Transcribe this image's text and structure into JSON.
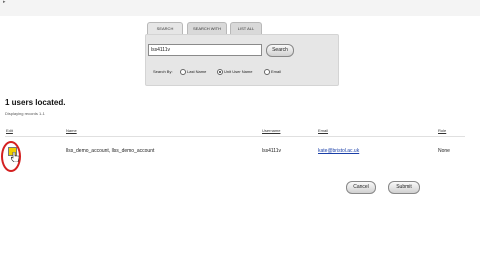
{
  "browser": {
    "corner_text": "▸"
  },
  "tabs": [
    {
      "label": "SEARCH",
      "active": true
    },
    {
      "label": "SEARCH WITH",
      "active": false
    },
    {
      "label": "LIST ALL",
      "active": false
    }
  ],
  "search": {
    "value": "lss4111v",
    "button_label": "Search"
  },
  "search_by": {
    "label": "Search By:",
    "options": [
      {
        "label": "Last Name",
        "checked": false
      },
      {
        "label": "Unit User Name",
        "checked": true
      },
      {
        "label": "Email",
        "checked": false
      }
    ]
  },
  "results": {
    "count_text": "1 users located.",
    "displaying_text": "Displaying records 1-1",
    "columns": [
      "Edit",
      "Name",
      "Username",
      "Email",
      "Role"
    ],
    "rows": [
      {
        "name": "llss_demo_account, llss_demo_account",
        "username": "lss4111v",
        "email": "kate@bristol.ac.uk",
        "role": "None"
      }
    ]
  },
  "actions": {
    "cancel_label": "Cancel",
    "submit_label": "Submit"
  },
  "colors": {
    "highlight": "#d42020",
    "edit_box": "#f0d000",
    "link": "#1a3fa8"
  }
}
